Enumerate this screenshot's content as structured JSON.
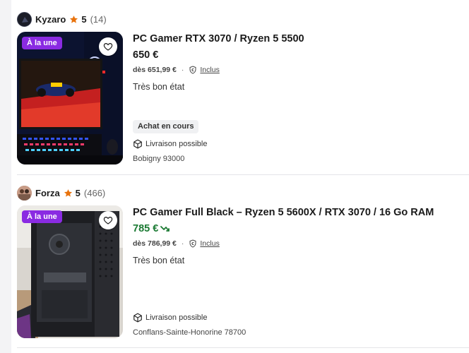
{
  "listings": [
    {
      "seller": {
        "name": "Kyzaro",
        "rating": "5",
        "reviews": "(14)"
      },
      "badge": "À la une",
      "title": "PC Gamer RTX 3070 / Ryzen 5 5500",
      "price": "650 €",
      "price_color": "#1a1a1a",
      "price_trend": false,
      "fees_from": "dès 651,99 €",
      "protection": "Inclus",
      "condition": "Très bon état",
      "status": "Achat en cours",
      "delivery": "Livraison possible",
      "location": "Bobigny 93000"
    },
    {
      "seller": {
        "name": "Forza",
        "rating": "5",
        "reviews": "(466)"
      },
      "badge": "À la une",
      "title": "PC Gamer Full Black – Ryzen 5 5600X / RTX 3070 / 16 Go RAM",
      "price": "785 €",
      "price_color": "#1b7a33",
      "price_trend": true,
      "fees_from": "dès 786,99 €",
      "protection": "Inclus",
      "condition": "Très bon état",
      "delivery": "Livraison possible",
      "location": "Conflans-Sainte-Honorine 78700"
    }
  ],
  "icons": {
    "star": "star-icon",
    "favorite": "heart-icon",
    "protection": "shield-icon",
    "delivery": "box-icon",
    "trend": "trend-down-icon"
  },
  "colors": {
    "badge_bg": "#8a2be2",
    "star": "#e8720c",
    "price_drop": "#1b7a33"
  }
}
